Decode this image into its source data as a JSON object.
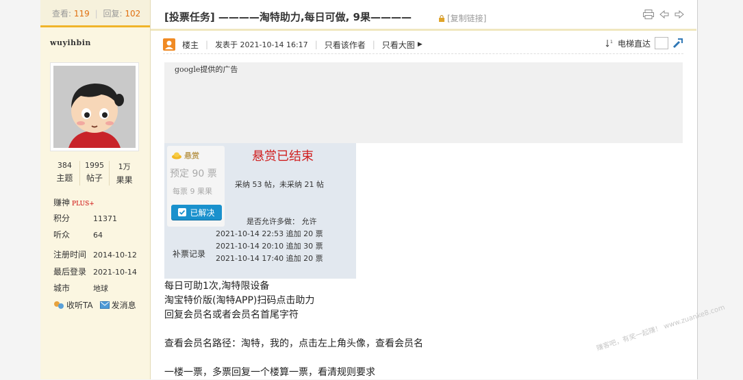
{
  "sidebar": {
    "views_label": "查看:",
    "views": "119",
    "replies_label": "回复:",
    "replies": "102",
    "username": "wuyihbin",
    "stats": [
      {
        "value": "384",
        "label": "主题"
      },
      {
        "value": "1995",
        "label": "帖子"
      },
      {
        "value": "1万",
        "label": "果果"
      }
    ],
    "rank": "赚神",
    "rank_badge": "PLUS+",
    "fields": [
      {
        "key": "积分",
        "value": "11371"
      },
      {
        "key": "听众",
        "value": "64"
      },
      {
        "key": "注册时间",
        "value": "2014-10-12"
      },
      {
        "key": "最后登录",
        "value": "2021-10-14"
      },
      {
        "key": "城市",
        "value": "地球"
      }
    ],
    "follow_label": "收听TA",
    "message_label": "发消息"
  },
  "thread": {
    "title": "[投票任务] ————淘特助力,每日可做, 9果————",
    "copy_link": "[复制链接]"
  },
  "author_bar": {
    "floor": "楼主",
    "posted": "发表于 2021-10-14 16:17",
    "only_author": "只看该作者",
    "big_image": "只看大图",
    "elevator": "电梯直达"
  },
  "ad": {
    "label": "google提供的广告"
  },
  "reward": {
    "badge_title": "悬赏",
    "planned": "预定 90 票",
    "per": "每票 9 果果",
    "solved": "已解决",
    "ended": "悬赏已结束",
    "stats": "采纳 53 帖，未采纳 21 帖",
    "multi": "是否允许多做： 允许",
    "log_label": "补票记录",
    "log": [
      "2021-10-14 22:53 追加 20 票",
      "2021-10-14 20:10 追加 30 票",
      "2021-10-14 17:40 追加 20 票"
    ]
  },
  "content": {
    "lines": [
      "每日可助1次,淘特限设备",
      "淘宝特价版(淘特APP)扫码点击助力",
      "回复会员名或者会员名首尾字符",
      "",
      "查看会员名路径：淘特，我的，点击左上角头像，查看会员名",
      "",
      "一楼一票，多票回复一个楼算一票，看清规则要求"
    ]
  },
  "watermark": "赚客吧，有奖一起赚！ www.zuanke8.com"
}
